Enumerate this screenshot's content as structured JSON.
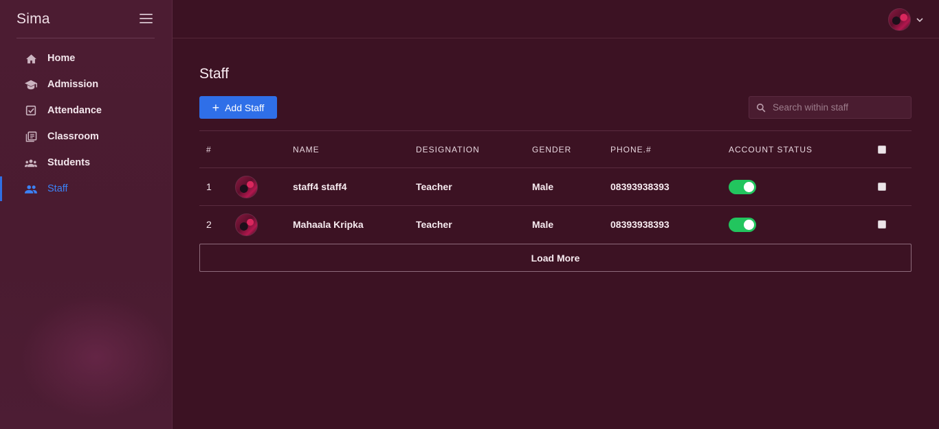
{
  "app": {
    "brand": "Sima"
  },
  "sidebar": {
    "items": [
      {
        "label": "Home",
        "icon": "home-icon"
      },
      {
        "label": "Admission",
        "icon": "graduation-cap-icon"
      },
      {
        "label": "Attendance",
        "icon": "checkbox-icon"
      },
      {
        "label": "Classroom",
        "icon": "library-books-icon"
      },
      {
        "label": "Students",
        "icon": "group-icon"
      },
      {
        "label": "Staff",
        "icon": "people-icon",
        "active": true
      }
    ]
  },
  "page": {
    "title": "Staff",
    "add_button": "Add Staff",
    "search_placeholder": "Search within staff",
    "load_more": "Load More"
  },
  "table": {
    "headers": {
      "num": "#",
      "name": "NAME",
      "designation": "DESIGNATION",
      "gender": "GENDER",
      "phone": "PHONE.#",
      "status": "ACCOUNT STATUS"
    },
    "rows": [
      {
        "num": "1",
        "name": "staff4 staff4",
        "designation": "Teacher",
        "gender": "Male",
        "phone": "08393938393",
        "active": true
      },
      {
        "num": "2",
        "name": "Mahaala Kripka",
        "designation": "Teacher",
        "gender": "Male",
        "phone": "08393938393",
        "active": true
      }
    ]
  },
  "colors": {
    "background": "#3c1223",
    "sidebar": "#4a1b30",
    "accent": "#2f6fe8",
    "toggle_on": "#22c55e"
  }
}
